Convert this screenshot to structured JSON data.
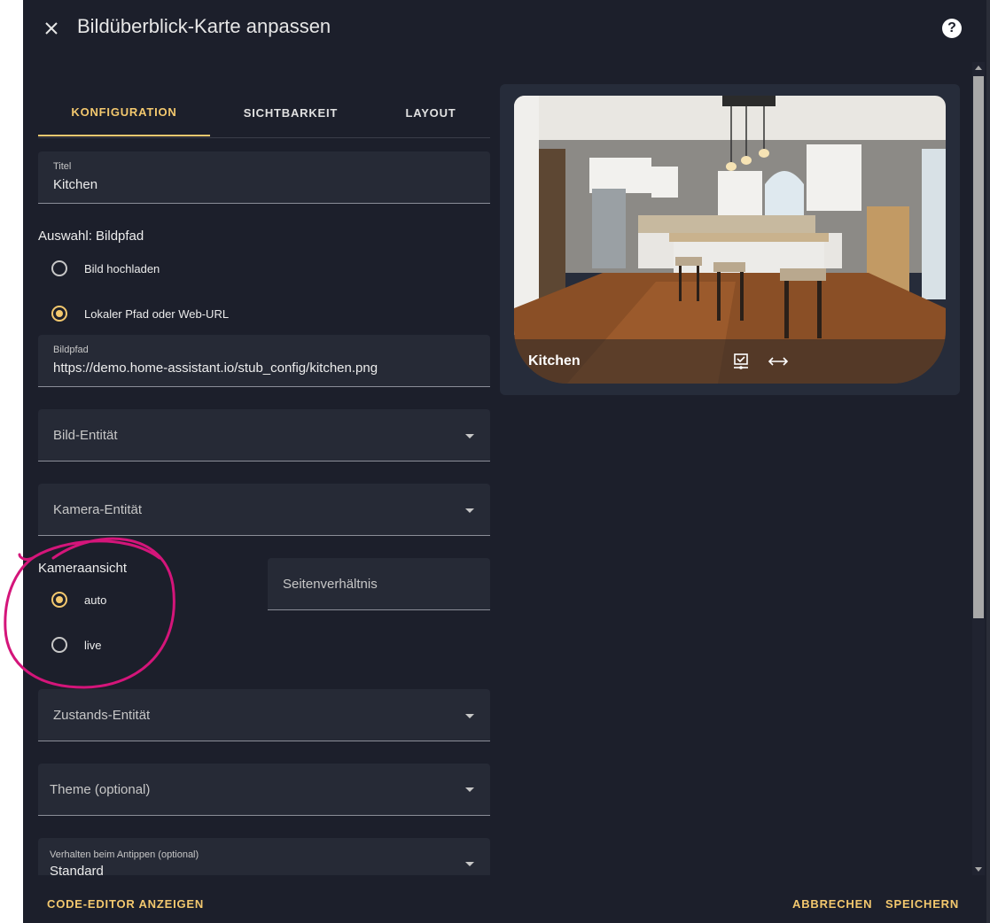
{
  "dialog": {
    "title": "Bildüberblick-Karte anpassen"
  },
  "tabs": [
    {
      "label": "KONFIGURATION"
    },
    {
      "label": "SICHTBARKEIT"
    },
    {
      "label": "LAYOUT"
    }
  ],
  "form": {
    "titel": {
      "label": "Titel",
      "value": "Kitchen"
    },
    "bildpfad_section": "Auswahl: Bildpfad",
    "options_bild": [
      {
        "label": "Bild hochladen",
        "checked": false
      },
      {
        "label": "Lokaler Pfad oder Web-URL",
        "checked": true
      }
    ],
    "bildpfad": {
      "label": "Bildpfad",
      "value": "https://demo.home-assistant.io/stub_config/kitchen.png"
    },
    "bild_entitaet": {
      "label": "Bild-Entität"
    },
    "kamera_entitaet": {
      "label": "Kamera-Entität"
    },
    "kameraansicht_section": "Kameraansicht",
    "options_kamera": [
      {
        "label": "auto",
        "checked": true
      },
      {
        "label": "live",
        "checked": false
      }
    ],
    "seitenverhaeltnis": {
      "label": "Seitenverhältnis"
    },
    "zustands_entitaet": {
      "label": "Zustands-Entität"
    },
    "theme": {
      "label": "Theme (optional)"
    },
    "tap_action": {
      "label": "Verhalten beim Antippen (optional)",
      "value": "Standard"
    }
  },
  "preview": {
    "card_title": "Kitchen"
  },
  "footer": {
    "code_editor": "CODE-EDITOR ANZEIGEN",
    "cancel": "ABBRECHEN",
    "save": "SPEICHERN"
  },
  "colors": {
    "accent": "#f3c86e",
    "background": "#1c1f2b",
    "field": "#262a36",
    "annotation": "#d4157a"
  }
}
